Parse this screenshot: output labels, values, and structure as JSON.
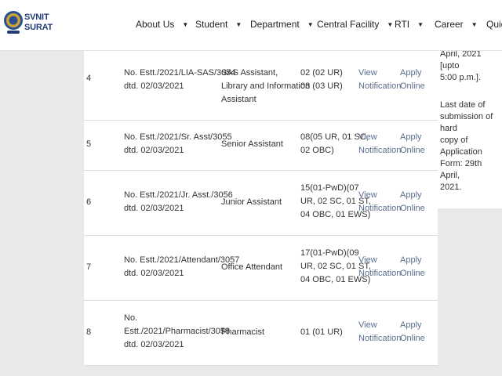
{
  "logo": {
    "line1": "SVNIT",
    "line2": "SURAT"
  },
  "nav": [
    {
      "label": "About Us"
    },
    {
      "label": "Student"
    },
    {
      "label": "Department"
    },
    {
      "label": "Central Facility"
    },
    {
      "label": "RTI"
    },
    {
      "label": "Career"
    },
    {
      "label": "Quic"
    }
  ],
  "rows": [
    {
      "sno": "4",
      "ref": [
        "No. Estt./2021/LIA-SAS/3054",
        "dtd. 02/03/2021"
      ],
      "post": [
        "SAS Assistant,",
        "Library and Information",
        "Assistant"
      ],
      "vacancy": [
        "02 (02 UR)",
        "03 (03 UR)"
      ],
      "notify": [
        "View",
        "Notification"
      ],
      "apply": [
        "Apply",
        "Online"
      ]
    },
    {
      "sno": "5",
      "ref": [
        "No. Estt./2021/Sr. Asst/3055",
        "dtd. 02/03/2021"
      ],
      "post": [
        "Senior Assistant"
      ],
      "vacancy": [
        "08(05 UR, 01 SC,",
        "02 OBC)"
      ],
      "notify": [
        "View",
        "Notification"
      ],
      "apply": [
        "Apply",
        "Online"
      ]
    },
    {
      "sno": "6",
      "ref": [
        "No. Estt./2021/Jr. Asst./3056",
        "dtd. 02/03/2021"
      ],
      "post": [
        "Junior Assistant"
      ],
      "vacancy": [
        "15(01-PwD)(07",
        "UR, 02 SC, 01 ST,",
        "04 OBC, 01 EWS)"
      ],
      "notify": [
        "View",
        "Notification"
      ],
      "apply": [
        "Apply",
        "Online"
      ]
    },
    {
      "sno": "7",
      "ref": [
        "No. Estt./2021/Attendant/3057",
        "dtd. 02/03/2021"
      ],
      "post": [
        "Office Attendant"
      ],
      "vacancy": [
        "17(01-PwD)(09",
        "UR, 02 SC, 01 ST,",
        "04 OBC, 01 EWS)"
      ],
      "notify": [
        "View",
        "Notification"
      ],
      "apply": [
        "Apply",
        "Online"
      ]
    },
    {
      "sno": "8",
      "ref": [
        "No.",
        "Estt./2021/Pharmacist/3058",
        "dtd. 02/03/2021"
      ],
      "post": [
        "Pharmacist"
      ],
      "vacancy": [
        "01 (01 UR)"
      ],
      "notify": [
        "View",
        "Notification"
      ],
      "apply": [
        "Apply",
        "Online"
      ]
    }
  ],
  "side_note": {
    "top": [
      "April, 2021 [upto",
      "5:00 p.m.]."
    ],
    "bottom": [
      "Last date of",
      "submission of hard",
      "copy of Application",
      "Form: 29th April,",
      "2021."
    ]
  }
}
